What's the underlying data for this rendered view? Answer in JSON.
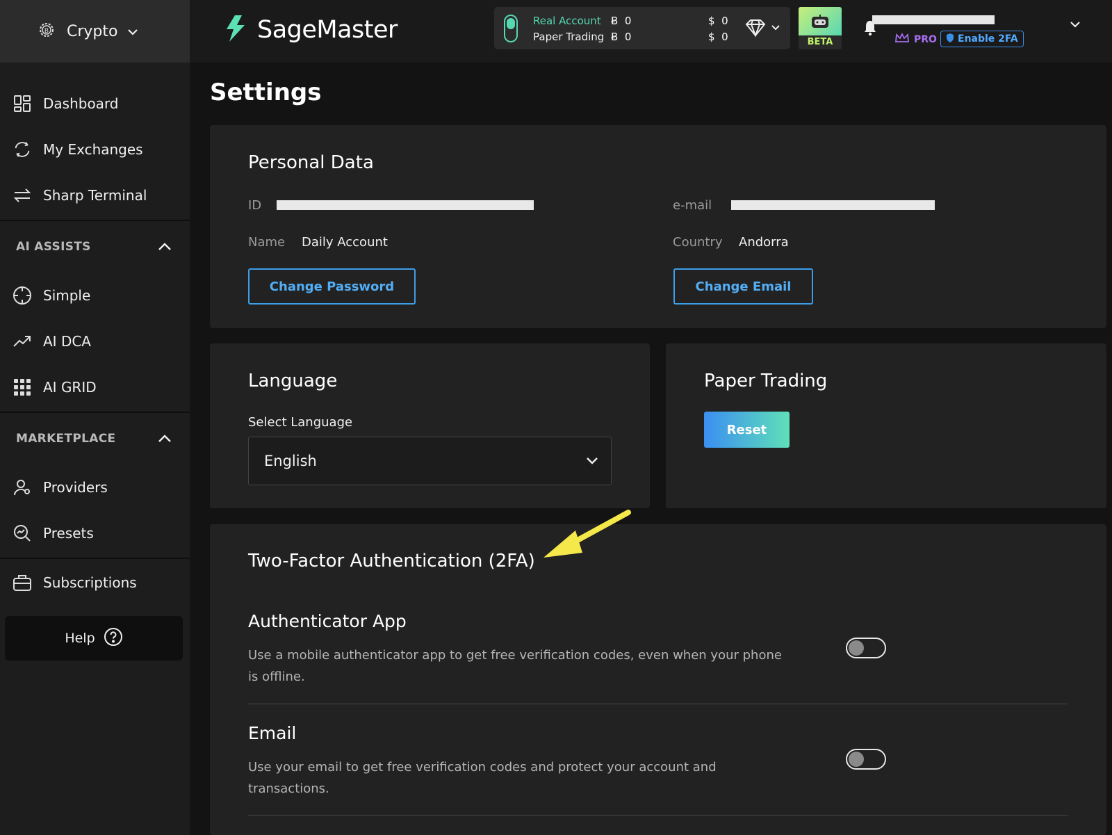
{
  "sidebar": {
    "market": "Crypto",
    "items_top": [
      {
        "label": "Dashboard",
        "icon": "grid-icon"
      },
      {
        "label": "My Exchanges",
        "icon": "exchange-icon"
      },
      {
        "label": "Sharp Terminal",
        "icon": "transfer-arrows-icon"
      }
    ],
    "ai_assists": {
      "title": "AI ASSISTS",
      "items": [
        {
          "label": "Simple",
          "icon": "crosshair-icon"
        },
        {
          "label": "AI DCA",
          "icon": "trend-up-icon"
        },
        {
          "label": "AI GRID",
          "icon": "dots-grid-icon"
        }
      ]
    },
    "marketplace": {
      "title": "MARKETPLACE",
      "items": [
        {
          "label": "Providers",
          "icon": "user-icon"
        },
        {
          "label": "Presets",
          "icon": "search-chart-icon"
        }
      ]
    },
    "subscriptions": "Subscriptions",
    "help": "Help"
  },
  "topbar": {
    "brand": "SageMaster",
    "real_account": {
      "label": "Real Account",
      "btc": "0",
      "usd": "0",
      "btc_symbol": "Ƀ",
      "usd_symbol": "$"
    },
    "paper_trading": {
      "label": "Paper Trading",
      "btc": "0",
      "usd": "0",
      "btc_symbol": "Ƀ",
      "usd_symbol": "$"
    },
    "beta": "BETA",
    "pro": "PRO",
    "enable_2fa": "Enable 2FA"
  },
  "page": {
    "title": "Settings",
    "personal": {
      "title": "Personal Data",
      "id_label": "ID",
      "email_label": "e-mail",
      "name_label": "Name",
      "name_value": "Daily Account",
      "country_label": "Country",
      "country_value": "Andorra",
      "change_password": "Change Password",
      "change_email": "Change Email"
    },
    "language": {
      "title": "Language",
      "select_label": "Select Language",
      "selected": "English"
    },
    "paper": {
      "title": "Paper Trading",
      "reset": "Reset"
    },
    "twofa": {
      "title": "Two-Factor Authentication (2FA)",
      "options": [
        {
          "title": "Authenticator App",
          "desc1": "Use a mobile authenticator app to get free verification codes, even when your phone",
          "desc2": "is offline.",
          "enabled": false
        },
        {
          "title": "Email",
          "desc1": "Use your email to get free verification codes and protect your account and",
          "desc2": "transactions.",
          "enabled": false
        }
      ]
    }
  },
  "colors": {
    "accent": "#3d9ee8",
    "brand_green": "#56d8b0",
    "annotation_arrow": "#f5e84a"
  }
}
